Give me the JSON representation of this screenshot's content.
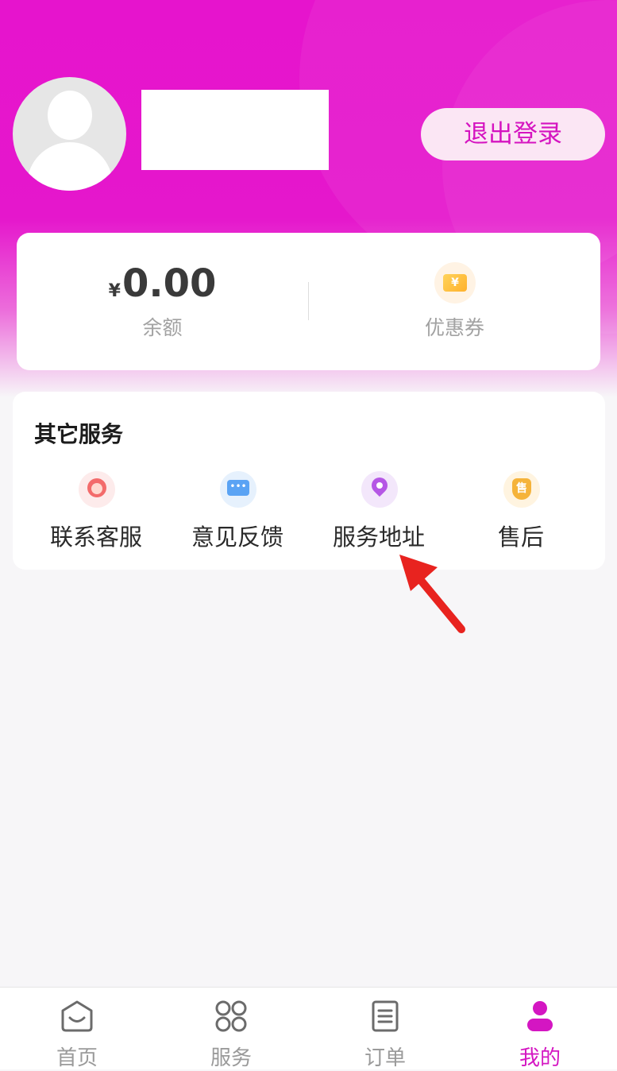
{
  "header": {
    "logout_label": "退出登录"
  },
  "wallet": {
    "currency_symbol": "¥",
    "balance_value": "0.00",
    "balance_label": "余额",
    "coupon_icon_glyph": "¥",
    "coupon_label": "优惠券"
  },
  "services": {
    "title": "其它服务",
    "items": [
      {
        "label": "联系客服",
        "icon": "headset-icon"
      },
      {
        "label": "意见反馈",
        "icon": "chat-bubble-icon",
        "glyph": "•••"
      },
      {
        "label": "服务地址",
        "icon": "location-pin-icon"
      },
      {
        "label": "售后",
        "icon": "after-sale-icon",
        "glyph": "售"
      }
    ]
  },
  "tabbar": {
    "items": [
      {
        "label": "首页",
        "icon": "home-icon"
      },
      {
        "label": "服务",
        "icon": "grid-circles-icon"
      },
      {
        "label": "订单",
        "icon": "list-document-icon"
      },
      {
        "label": "我的",
        "icon": "user-icon",
        "active": true
      }
    ]
  },
  "colors": {
    "brand": "#e614cd",
    "active_tab": "#d416c2",
    "annotation_arrow": "#e8231f"
  }
}
